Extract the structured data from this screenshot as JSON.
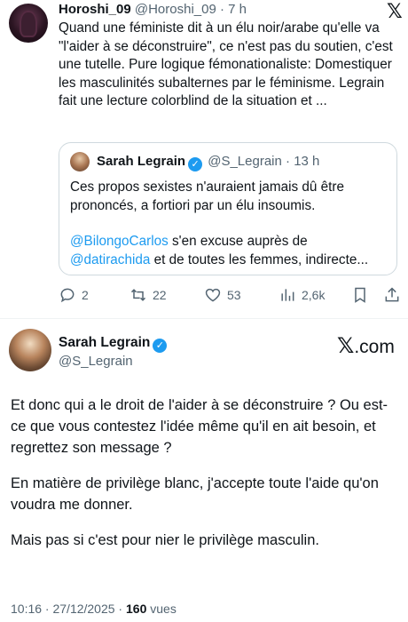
{
  "quoted_tweet": {
    "author_name": "Horoshi_09",
    "author_handle": "@Horoshi_09",
    "time_sep": " · ",
    "time": "7 h",
    "x_logo": "𝕏",
    "text": "Quand une féministe dit à un élu noir/arabe qu'elle va \"l'aider à se déconstruire\", ce n'est pas du soutien, c'est une tutelle. Pure logique fémonationaliste: Domestiquer les masculinités subalternes par le féminisme. Legrain fait une lecture colorblind de la situation et ...",
    "embedded": {
      "author_name": "Sarah Legrain",
      "author_handle": "@S_Legrain",
      "time_sep": " · ",
      "time": "13 h",
      "text1": "Ces propos sexistes n'auraient jamais dû être prononcés, a fortiori par un élu insoumis.",
      "mention1": "@BilongoCarlos",
      "text2": " s'en excuse auprès de",
      "mention2": "@datirachida",
      "text3": " et de toutes les femmes, indirecte..."
    },
    "actions": {
      "replies": "2",
      "reposts": "22",
      "likes": "53",
      "views": "2,6k"
    }
  },
  "main_tweet": {
    "author_name": "Sarah Legrain",
    "author_handle": "@S_Legrain",
    "brand": ".com",
    "brand_x": "𝕏",
    "paragraph1": "Et donc qui a le droit de l'aider à se déconstruire ? Ou est-ce que vous contestez l'idée même qu'il en ait besoin, et regrettez son message ?",
    "paragraph2": "En matière de privilège blanc, j'accepte toute l'aide qu'on voudra me donner.",
    "paragraph3": "Mais pas si c'est pour nier le privilège masculin.",
    "timestamp": "10:16 · 27/12/2025 · ",
    "views_count": "160",
    "views_label": " vues"
  },
  "colors": {
    "link": "#1d9bf0",
    "secondary_text": "#536471",
    "border": "#cfd9de"
  },
  "icons": [
    "reply-icon",
    "repost-icon",
    "like-icon",
    "views-icon",
    "bookmark-icon",
    "verified-icon",
    "x-logo-icon"
  ]
}
